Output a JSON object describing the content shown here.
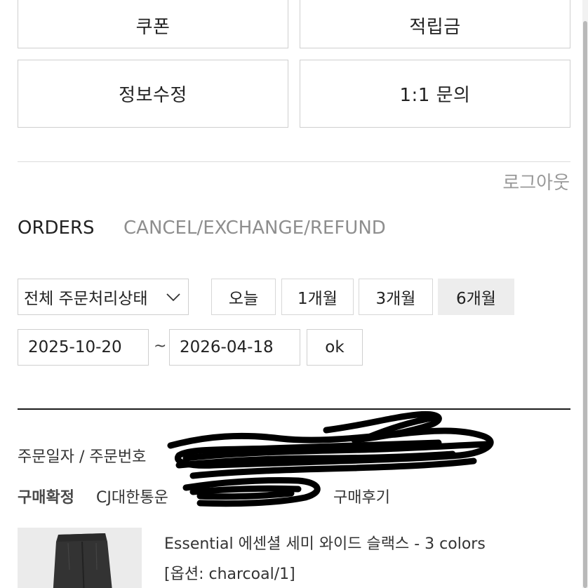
{
  "mypage_menu": {
    "coupon": "쿠폰",
    "points": "적립금",
    "edit_info": "정보수정",
    "inquiry": "1:1 문의"
  },
  "logout": "로그아웃",
  "tabs": {
    "orders": "ORDERS",
    "cancel_exchange_refund": "CANCEL/EXCHANGE/REFUND"
  },
  "filter": {
    "status_select": "전체 주문처리상태",
    "periods": [
      "오늘",
      "1개월",
      "3개월",
      "6개월"
    ],
    "selected_period": "6개월",
    "date_from": "2025-10-20",
    "separator": "~",
    "date_to": "2026-04-18",
    "submit": "ok"
  },
  "order": {
    "date_number_label": "주문일자 / 주문번호",
    "status": "구매확정",
    "carrier": "CJ대한통운",
    "review_link": "구매후기",
    "product": {
      "title": "Essential 에센셜 세미 와이드 슬랙스 - 3 colors",
      "option": "[옵션: charcoal/1]"
    }
  },
  "icons": {
    "select_chevron": "chevron-down-icon"
  },
  "colors": {
    "border": "#cfcfcf",
    "muted_text": "#8e8e8e",
    "selected_period_bg": "#ededed",
    "divider_strong": "#1c1c1c"
  }
}
